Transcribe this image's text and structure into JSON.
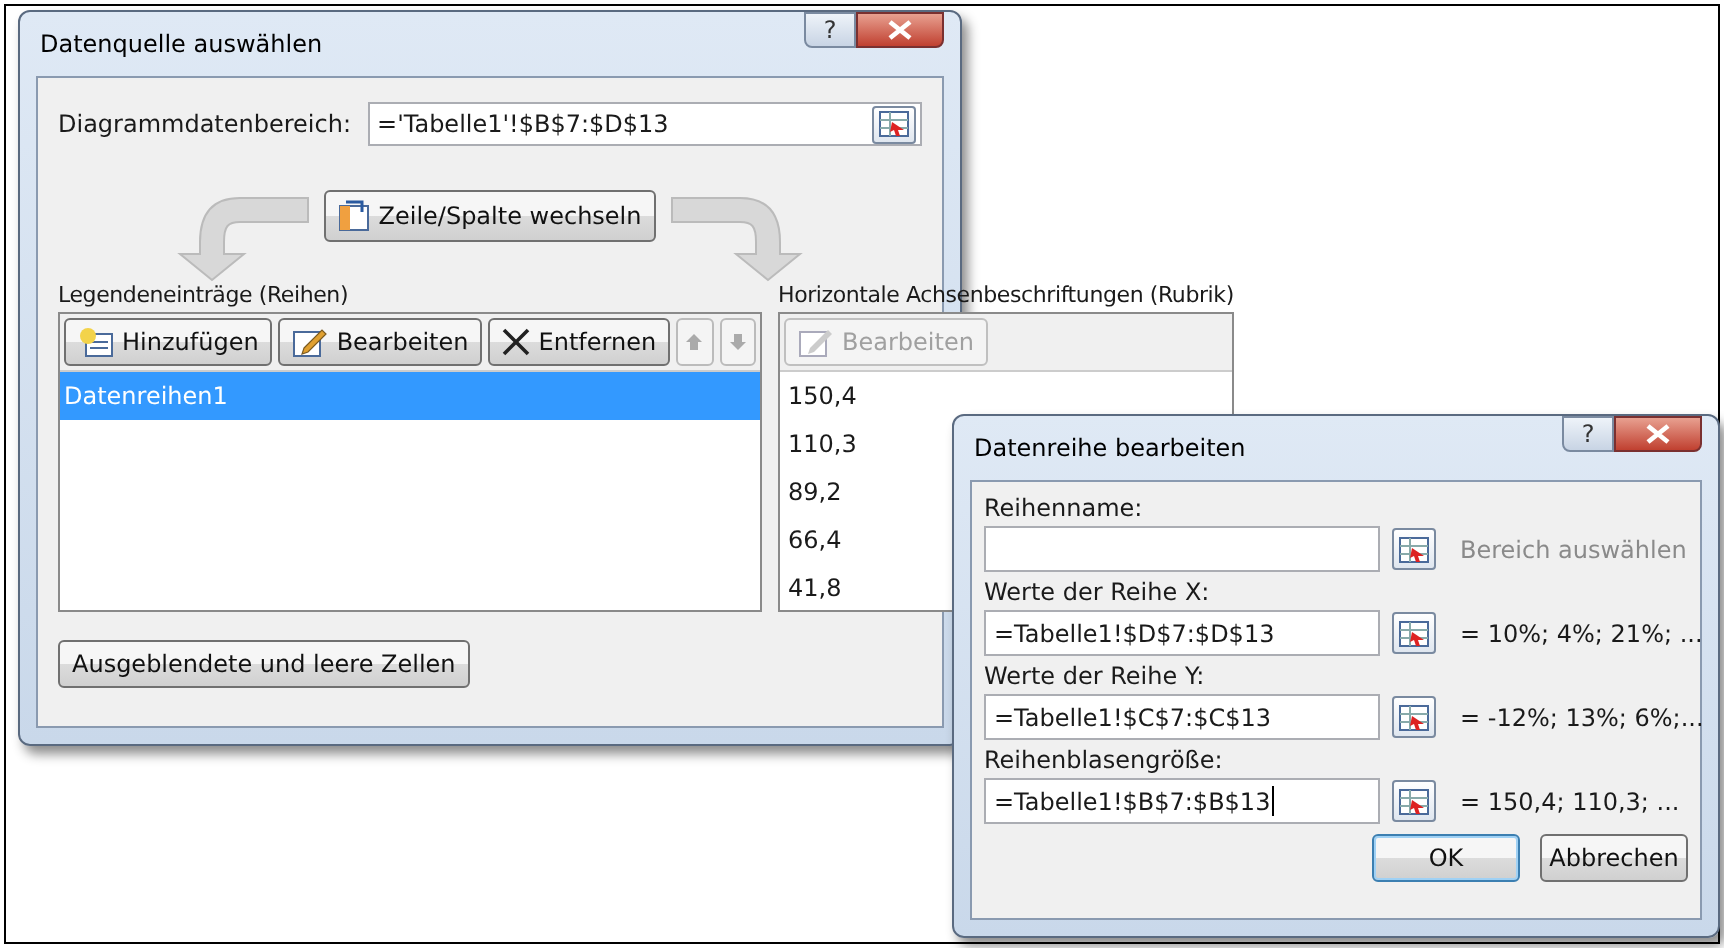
{
  "main_dialog": {
    "title": "Datenquelle auswählen",
    "help": "?",
    "range_label": "Diagrammdatenbereich:",
    "range_value": "='Tabelle1'!$B$7:$D$13",
    "switch_button": "Zeile/Spalte wechseln",
    "legend": {
      "title": "Legendeneinträge (Reihen)",
      "buttons": [
        {
          "kind": "add",
          "label": "Hinzufügen"
        },
        {
          "kind": "edit",
          "label": "Bearbeiten"
        },
        {
          "kind": "remove",
          "label": "Entfernen"
        },
        {
          "kind": "up"
        },
        {
          "kind": "down"
        }
      ],
      "items": [
        {
          "label": "Datenreihen1",
          "selected": true
        }
      ]
    },
    "axis": {
      "title": "Horizontale Achsenbeschriftungen (Rubrik)",
      "edit_button": {
        "label": "Bearbeiten",
        "disabled": true
      },
      "items": [
        "150,4",
        "110,3",
        "89,2",
        "66,4",
        "41,8"
      ]
    },
    "hidden_cells_button": "Ausgeblendete und leere Zellen"
  },
  "series_dialog": {
    "title": "Datenreihe bearbeiten",
    "help": "?",
    "fields": [
      {
        "label": "Reihenname:",
        "hint": "Bereich auswählen"
      },
      {
        "label": "Werte der Reihe X:",
        "value": "=Tabelle1!$D$7:$D$13",
        "preview": "= 10%; 4%; 21%; ..."
      },
      {
        "label": "Werte der Reihe Y:",
        "value": "=Tabelle1!$C$7:$C$13",
        "preview": "= -12%; 13%; 6%;..."
      },
      {
        "label": "Reihenblasengröße:",
        "value": "=Tabelle1!$B$7:$B$13",
        "preview": "= 150,4; 110,3; ..."
      }
    ],
    "buttons": [
      {
        "label": "OK",
        "default": true
      },
      {
        "label": "Abbrechen",
        "default": false
      }
    ]
  }
}
